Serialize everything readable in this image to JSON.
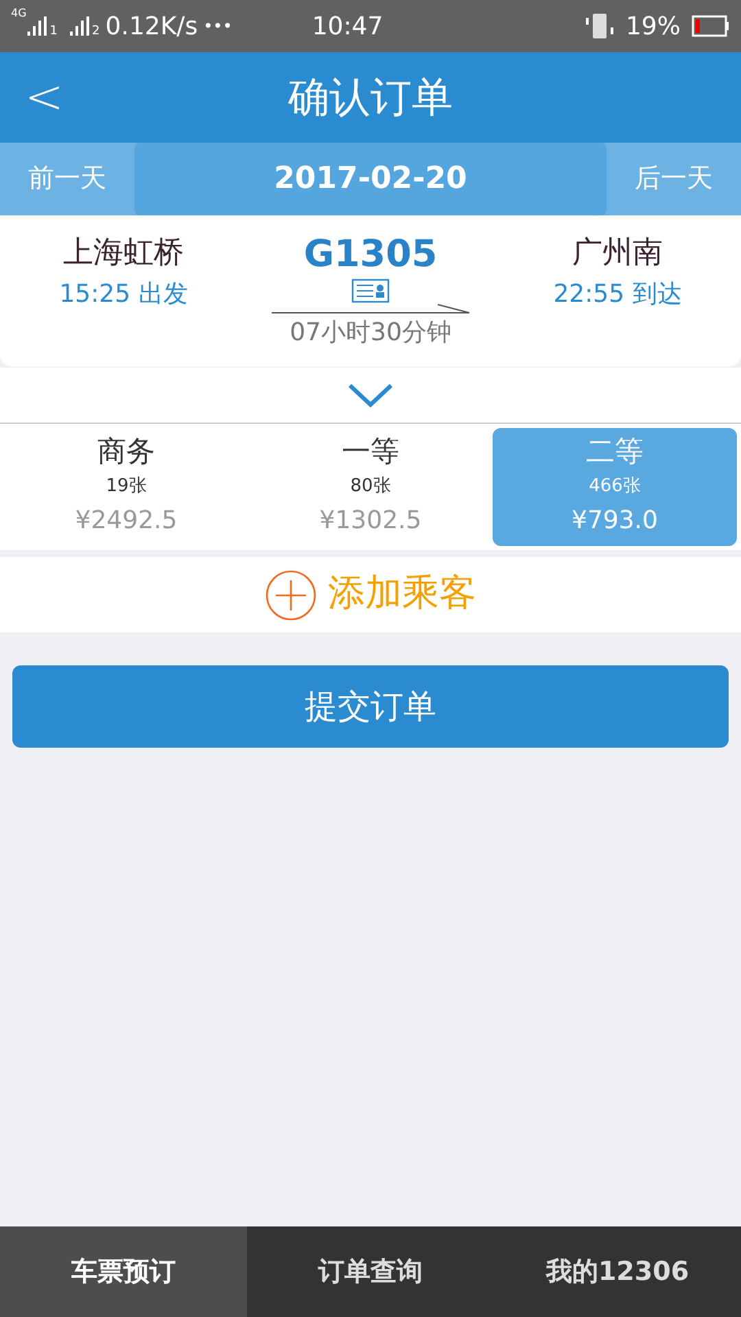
{
  "status_bar": {
    "network": "4G",
    "sim_1": "1",
    "sim_2": "2",
    "speed": "0.12K/s",
    "more": "•••",
    "time": "10:47",
    "battery": "19%"
  },
  "header": {
    "back": "<",
    "title": "确认订单"
  },
  "date_bar": {
    "prev": "前一天",
    "date": "2017-02-20",
    "next": "后一天"
  },
  "train": {
    "from": "上海虹桥",
    "depart": "15:25 出发",
    "number": "G1305",
    "to": "广州南",
    "arrive": "22:55 到达",
    "duration": "07小时30分钟"
  },
  "seats": [
    {
      "name": "商务",
      "count": "19张",
      "price": "¥2492.5",
      "selected": false
    },
    {
      "name": "一等",
      "count": "80张",
      "price": "¥1302.5",
      "selected": false
    },
    {
      "name": "二等",
      "count": "466张",
      "price": "¥793.0",
      "selected": true
    }
  ],
  "add_passenger": "添加乘客",
  "submit": "提交订单",
  "tabs": [
    {
      "label": "车票预订",
      "selected": true
    },
    {
      "label": "订单查询",
      "selected": false
    },
    {
      "label": "我的12306",
      "selected": false
    }
  ]
}
